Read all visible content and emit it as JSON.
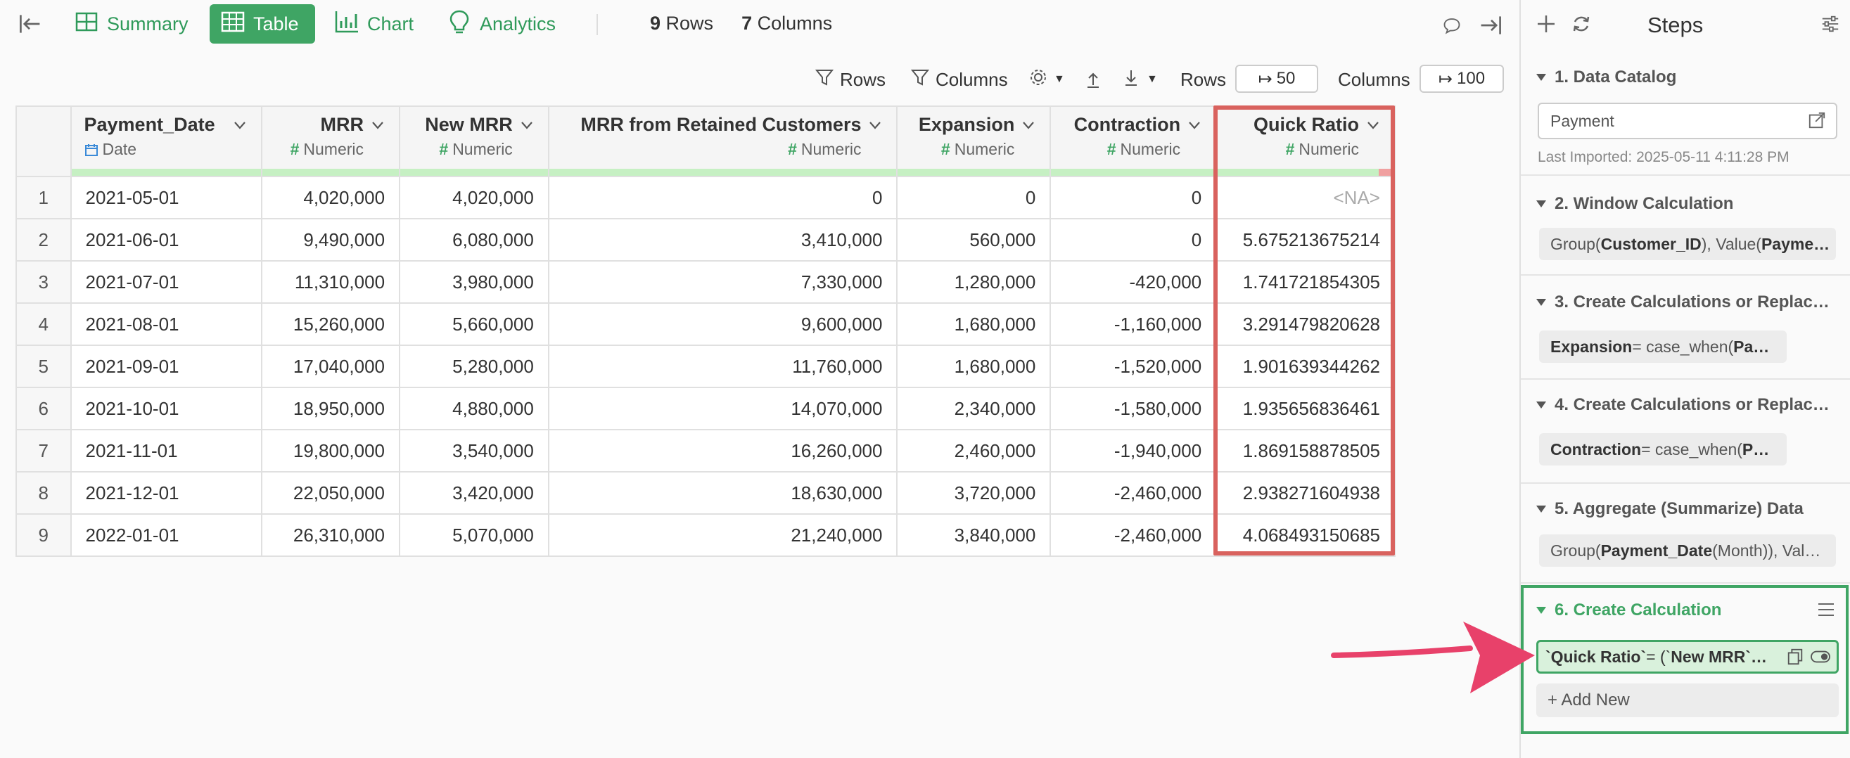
{
  "topbar": {
    "tabs": [
      {
        "label": "Summary",
        "icon": "summary-icon",
        "active": false
      },
      {
        "label": "Table",
        "icon": "table-icon",
        "active": true
      },
      {
        "label": "Chart",
        "icon": "chart-icon",
        "active": false
      },
      {
        "label": "Analytics",
        "icon": "lightbulb-icon",
        "active": false
      }
    ],
    "rows_count": "9",
    "rows_label": "Rows",
    "cols_count": "7",
    "cols_label": "Columns"
  },
  "toolbar2": {
    "rows_filter": "Rows",
    "columns_filter": "Columns",
    "rows_label": "Rows",
    "rows_value": "50",
    "columns_label": "Columns",
    "columns_value": "100"
  },
  "table": {
    "columns": [
      {
        "name": "Payment_Date",
        "type": "Date"
      },
      {
        "name": "MRR",
        "type": "Numeric"
      },
      {
        "name": "New MRR",
        "type": "Numeric"
      },
      {
        "name": "MRR from Retained Customers",
        "type": "Numeric"
      },
      {
        "name": "Expansion",
        "type": "Numeric"
      },
      {
        "name": "Contraction",
        "type": "Numeric"
      },
      {
        "name": "Quick Ratio",
        "type": "Numeric"
      }
    ],
    "rows": [
      [
        "1",
        "2021-05-01",
        "4,020,000",
        "4,020,000",
        "0",
        "0",
        "0",
        "<NA>"
      ],
      [
        "2",
        "2021-06-01",
        "9,490,000",
        "6,080,000",
        "3,410,000",
        "560,000",
        "0",
        "5.675213675214"
      ],
      [
        "3",
        "2021-07-01",
        "11,310,000",
        "3,980,000",
        "7,330,000",
        "1,280,000",
        "-420,000",
        "1.741721854305"
      ],
      [
        "4",
        "2021-08-01",
        "15,260,000",
        "5,660,000",
        "9,600,000",
        "1,680,000",
        "-1,160,000",
        "3.291479820628"
      ],
      [
        "5",
        "2021-09-01",
        "17,040,000",
        "5,280,000",
        "11,760,000",
        "1,680,000",
        "-1,520,000",
        "1.901639344262"
      ],
      [
        "6",
        "2021-10-01",
        "18,950,000",
        "4,880,000",
        "14,070,000",
        "2,340,000",
        "-1,580,000",
        "1.935656836461"
      ],
      [
        "7",
        "2021-11-01",
        "19,800,000",
        "3,540,000",
        "16,260,000",
        "2,460,000",
        "-1,940,000",
        "1.869158878505"
      ],
      [
        "8",
        "2021-12-01",
        "22,050,000",
        "3,420,000",
        "18,630,000",
        "3,720,000",
        "-2,460,000",
        "2.938271604938"
      ],
      [
        "9",
        "2022-01-01",
        "26,310,000",
        "5,070,000",
        "21,240,000",
        "3,840,000",
        "-2,460,000",
        "4.068493150685"
      ]
    ]
  },
  "steps": {
    "title": "Steps",
    "step1": {
      "title": "1. Data Catalog",
      "value": "Payment",
      "note": "Last Imported: 2025-05-11 4:11:28 PM"
    },
    "step2": {
      "title": "2. Window Calculation",
      "pre1": "Group(",
      "b1": "Customer_ID",
      "mid": "), Value(",
      "b2": "Payme…"
    },
    "step3": {
      "title": "3. Create Calculations or Replac…",
      "b1": "Expansion",
      "rest": " = case_when(",
      "b2": "Pa…"
    },
    "step4": {
      "title": "4. Create Calculations or Replac…",
      "b1": "Contraction",
      "rest": " = case_when(",
      "b2": "P…"
    },
    "step5": {
      "title": "5. Aggregate (Summarize) Data",
      "pre1": "Group(",
      "b1": "Payment_Date",
      "rest": " (Month)), Val…"
    },
    "step6": {
      "title": "6. Create Calculation",
      "b1": "`Quick Ratio`",
      "mid": " = (`",
      "b2": "New MRR`…"
    },
    "add_new": "+ Add New"
  },
  "colors": {
    "accent": "#3fa564",
    "highlight": "#d9625e",
    "arrow": "#e8416a"
  }
}
